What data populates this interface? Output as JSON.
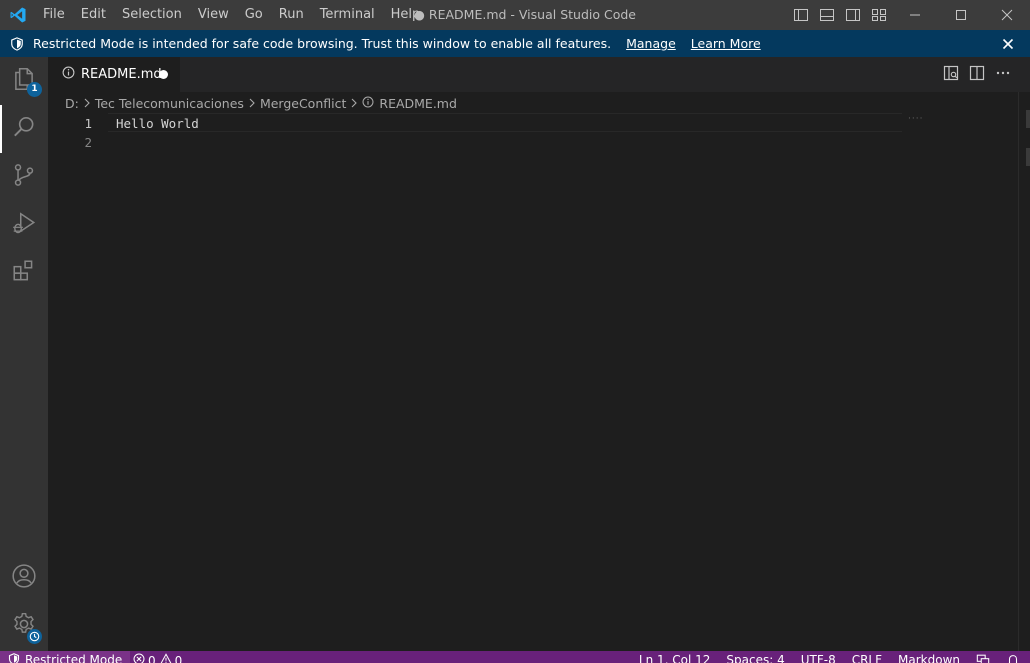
{
  "window": {
    "title": "README.md - Visual Studio Code",
    "dirty_marker": "●"
  },
  "menu": [
    "File",
    "Edit",
    "Selection",
    "View",
    "Go",
    "Run",
    "Terminal",
    "Help"
  ],
  "banner": {
    "message": "Restricted Mode is intended for safe code browsing. Trust this window to enable all features.",
    "manage": "Manage",
    "learn_more": "Learn More"
  },
  "activity": {
    "explorer_badge": "1"
  },
  "tab": {
    "label": "README.md"
  },
  "breadcrumb": {
    "drive": "D:",
    "folder1": "Tec Telecomunicaciones",
    "folder2": "MergeConflict",
    "file": "README.md"
  },
  "editor": {
    "lines": [
      {
        "number": "1",
        "text": "Hello World"
      },
      {
        "number": "2",
        "text": ""
      }
    ],
    "minimap_hint": "····"
  },
  "status": {
    "restricted": "Restricted Mode",
    "errors": "0",
    "warnings": "0",
    "position": "Ln 1, Col 12",
    "spaces": "Spaces: 4",
    "encoding": "UTF-8",
    "eol": "CRLF",
    "language": "Markdown"
  },
  "colors": {
    "titlebar": "#3c3c3c",
    "banner": "#04395e",
    "statusbar": "#68217a",
    "editor_bg": "#1e1e1e",
    "accent": "#0e639c"
  }
}
